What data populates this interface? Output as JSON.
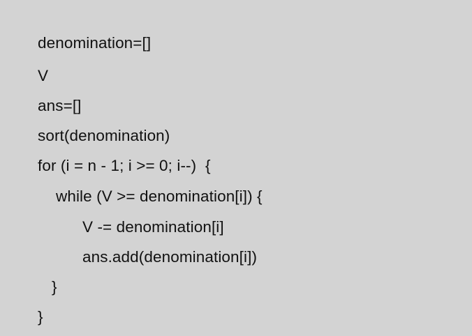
{
  "code": {
    "lines": [
      "denomination=[]",
      "V",
      "ans=[]",
      "sort(denomination)",
      "for (i = n - 1; i >= 0; i--)  {",
      "while (V >= denomination[i]) {",
      "V -= denomination[i]",
      "ans.add(denomination[i])",
      "}",
      "}"
    ]
  }
}
